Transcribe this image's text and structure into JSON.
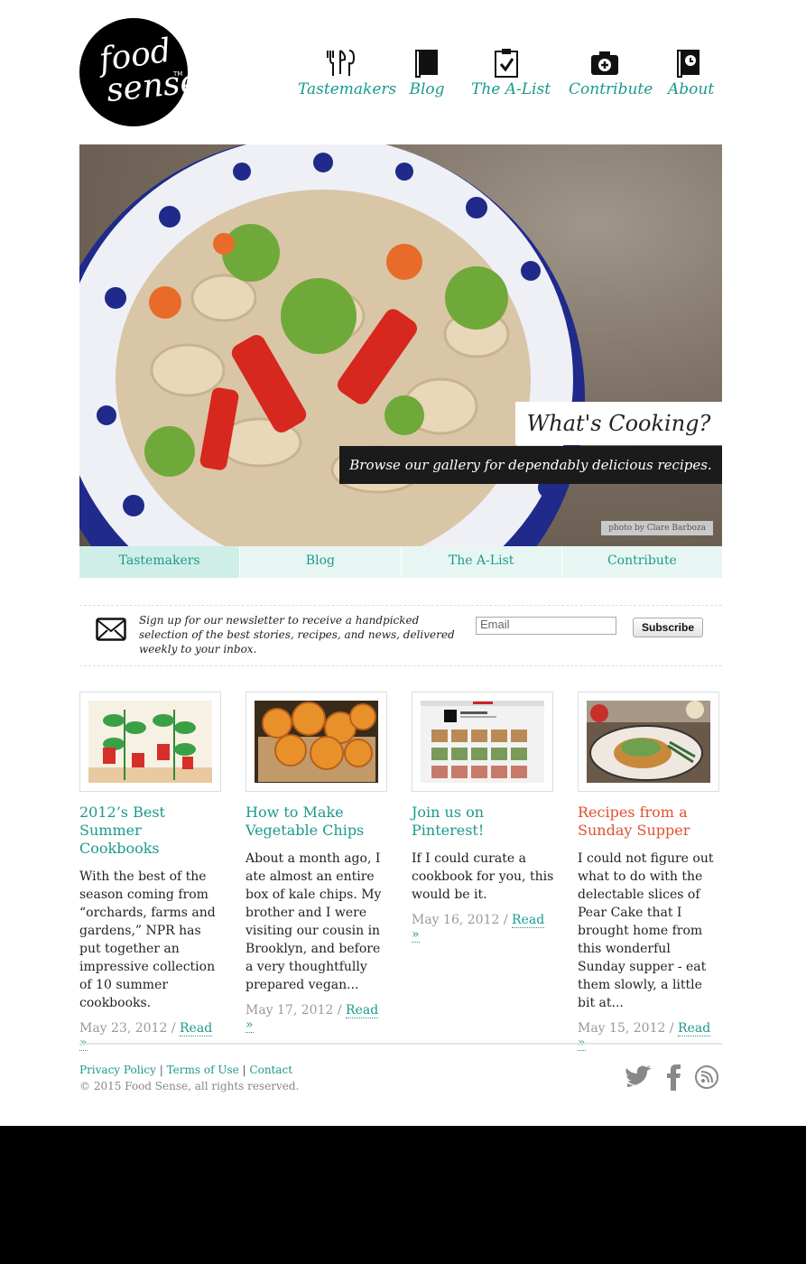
{
  "brand": {
    "line1": "food",
    "line2": "sense",
    "tm": "TM"
  },
  "nav": [
    {
      "label": "Tastemakers",
      "icon": "utensils-icon"
    },
    {
      "label": "Blog",
      "icon": "book-icon"
    },
    {
      "label": "The A-List",
      "icon": "clipboard-check-icon"
    },
    {
      "label": "Contribute",
      "icon": "camera-plus-icon"
    },
    {
      "label": "About",
      "icon": "about-book-icon"
    }
  ],
  "hero": {
    "heading": "What's Cooking?",
    "tagline": "Browse our gallery for dependably delicious recipes.",
    "credit": "photo by Clare Barboza"
  },
  "subnav": [
    "Tastemakers",
    "Blog",
    "The A-List",
    "Contribute"
  ],
  "newsletter": {
    "text": "Sign up for our newsletter to receive a handpicked selection of the best stories, recipes, and news, delivered weekly to your inbox.",
    "placeholder": "Email",
    "button": "Subscribe"
  },
  "posts": [
    {
      "title": "2012’s Best Summer Cookbooks",
      "body": "With the best of the season coming from “orchards, farms and gardens,” NPR has put together an impressive collection of 10 summer cookbooks.",
      "date": "May 23, 2012",
      "sep": "/",
      "read": "Read »"
    },
    {
      "title": "How to Make Vegetable Chips",
      "body": "About a month ago, I ate almost an entire box of kale chips. My brother and I were visiting our cousin in Brooklyn, and before a very thoughtfully prepared vegan...",
      "date": "May 17, 2012",
      "sep": "/",
      "read": "Read »"
    },
    {
      "title": "Join us on Pinterest!",
      "body": "If I could curate a cookbook for you, this would be it.",
      "date": "May 16, 2012",
      "sep": "/",
      "read": "Read »"
    },
    {
      "title": "Recipes from a Sunday Supper",
      "body": "I could not figure out what to do with the delectable slices of Pear Cake that I brought home from this wonderful Sunday supper - eat them slowly, a little bit at...",
      "date": "May 15, 2012",
      "sep": "/",
      "read": "Read »"
    }
  ],
  "footer": {
    "links": [
      "Privacy Policy",
      "Terms of Use",
      "Contact"
    ],
    "divider": "|",
    "copyright": "© 2015 Food Sense, all rights reserved.",
    "social": [
      "twitter-icon",
      "facebook-icon",
      "rss-icon"
    ]
  },
  "colors": {
    "accent": "#1a9a8c",
    "highlight": "#e0522c",
    "tab_bg": "#e8f6f3"
  }
}
